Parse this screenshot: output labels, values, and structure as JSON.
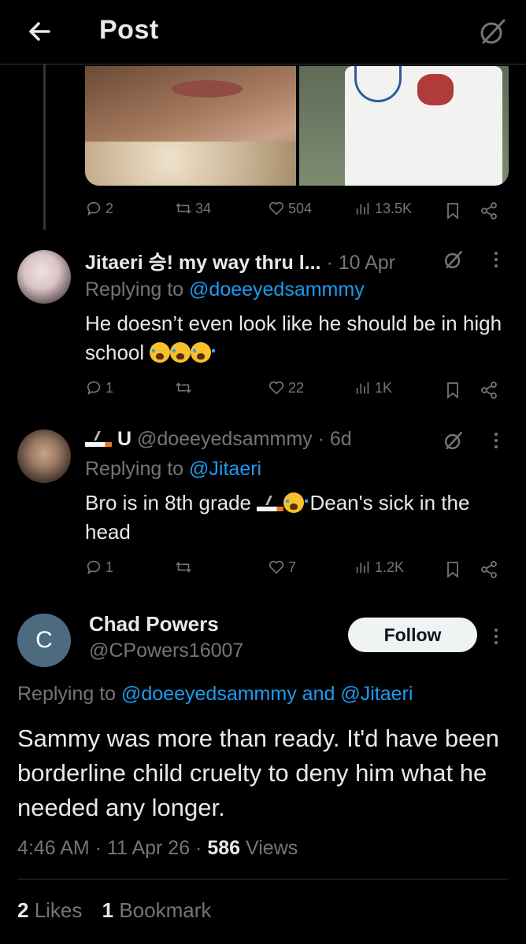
{
  "header": {
    "title": "Post",
    "back_icon": "arrow-left-icon",
    "grok_icon": "grok-icon"
  },
  "top_post_actions": {
    "replies": "2",
    "reposts": "34",
    "likes": "504",
    "views": "13.5K"
  },
  "replies": [
    {
      "name": "Jitaeri 승! my way thru l...",
      "handle": "",
      "time": "· 10 Apr",
      "replying_label": "Replying to ",
      "replying_to": "@doeeyedsammmy",
      "text_1": "He doesn’t even look like he should be in high school ",
      "actions": {
        "replies": "1",
        "reposts": "",
        "likes": "22",
        "views": "1K"
      }
    },
    {
      "name": "U",
      "handle": "@doeeyedsammmy",
      "time": "· 6d",
      "replying_label": "Replying to ",
      "replying_to": "@Jitaeri",
      "text_1": "Bro is in 8th grade ",
      "text_2": " Dean's sick in the head",
      "actions": {
        "replies": "1",
        "reposts": "",
        "likes": "7",
        "views": "1.2K"
      }
    }
  ],
  "main_post": {
    "avatar_letter": "C",
    "name": "Chad Powers",
    "handle": "@CPowers16007",
    "follow_label": "Follow",
    "replying_label": "Replying to ",
    "replying_to_1": "@doeeyedsammmy",
    "replying_and": " and ",
    "replying_to_2": "@Jitaeri",
    "text": "Sammy was more than ready.  It'd have been borderline child cruelty to deny him what he needed any longer.",
    "time": "4:46 AM · 11 Apr 26 · ",
    "views_count": "586",
    "views_label": " Views",
    "likes_count": "2",
    "likes_label": " Likes",
    "bookmarks_count": "1",
    "bookmarks_label": " Bookmark"
  },
  "colors": {
    "background": "#000000",
    "text": "#e7e9ea",
    "muted": "#71767b",
    "link": "#1d9bf0",
    "divider": "#2f3336"
  }
}
